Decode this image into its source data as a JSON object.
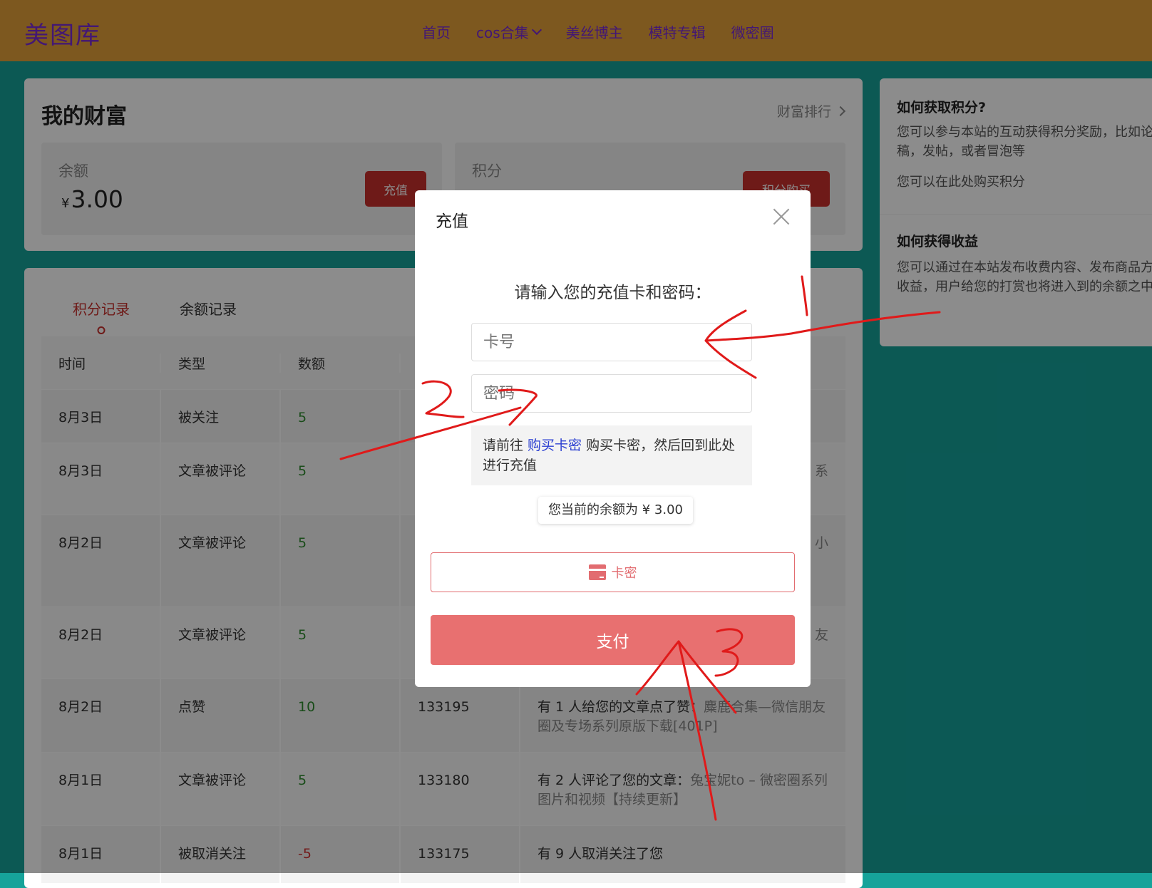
{
  "header": {
    "logo": "美图库",
    "nav": [
      "首页",
      "cos合集",
      "美丝博主",
      "模特专辑",
      "微密圈"
    ]
  },
  "wealth": {
    "title": "我的财富",
    "rank_link": "财富排行",
    "balance_label": "余额",
    "balance_currency": "¥",
    "balance_value": "3.00",
    "recharge_button": "充值",
    "points_label": "积分",
    "points_buy_button": "积分购买"
  },
  "records": {
    "tabs": [
      "积分记录",
      "余额记录"
    ],
    "columns": [
      "时间",
      "类型",
      "数额",
      "",
      ""
    ],
    "rows": [
      {
        "date": "8月3日",
        "type": "被关注",
        "amount": "5",
        "balance": "",
        "desc": ""
      },
      {
        "date": "8月3日",
        "type": "文章被评论",
        "amount": "5",
        "balance": "",
        "desc": "系"
      },
      {
        "date": "8月2日",
        "type": "文章被评论",
        "amount": "5",
        "balance": "",
        "desc": "频 小"
      },
      {
        "date": "8月2日",
        "type": "文章被评论",
        "amount": "5",
        "balance": "",
        "desc": "友"
      },
      {
        "date": "8月2日",
        "type": "点赞",
        "amount": "10",
        "balance": "133195",
        "desc": "有 1 人给您的文章点了赞：",
        "desc_link": "麋鹿合集—微信朋友圈及专场系列原版下载[401P]"
      },
      {
        "date": "8月1日",
        "type": "文章被评论",
        "amount": "5",
        "balance": "133180",
        "desc": "有 2 人评论了您的文章：",
        "desc_link": "兔宝妮to – 微密圈系列图片和视频【持续更新】"
      },
      {
        "date": "8月1日",
        "type": "被取消关注",
        "amount": "-5",
        "balance": "133175",
        "desc": "有 9 人取消关注了您",
        "desc_link": ""
      }
    ]
  },
  "sidebar": {
    "q1": "如何获取积分?",
    "a1": "您可以参与本站的互动获得积分奖励，比如论，投稿，发帖，或者冒泡等",
    "a1b": "您可以在此处购买积分",
    "q2": "如何获得收益",
    "a2": "您可以通过在本站发布收费内容、发布商品方式获得收益，用户给您的打赏也将进入到的余额之中"
  },
  "modal": {
    "title": "充值",
    "prompt": "请输入您的充值卡和密码：",
    "card_placeholder": "卡号",
    "password_placeholder": "密码",
    "note_prefix": "请前往 ",
    "note_link": "购买卡密",
    "note_suffix": " 购买卡密，然后回到此处进行充值",
    "balance_text": "您当前的余额为 ¥ 3.00",
    "method_label": "卡密",
    "pay_button": "支付"
  },
  "colors": {
    "header": "#e3a03a",
    "page_bg": "#16a39a",
    "accent": "#c9302c",
    "pay": "#e87070",
    "link": "#2b3fd1"
  }
}
